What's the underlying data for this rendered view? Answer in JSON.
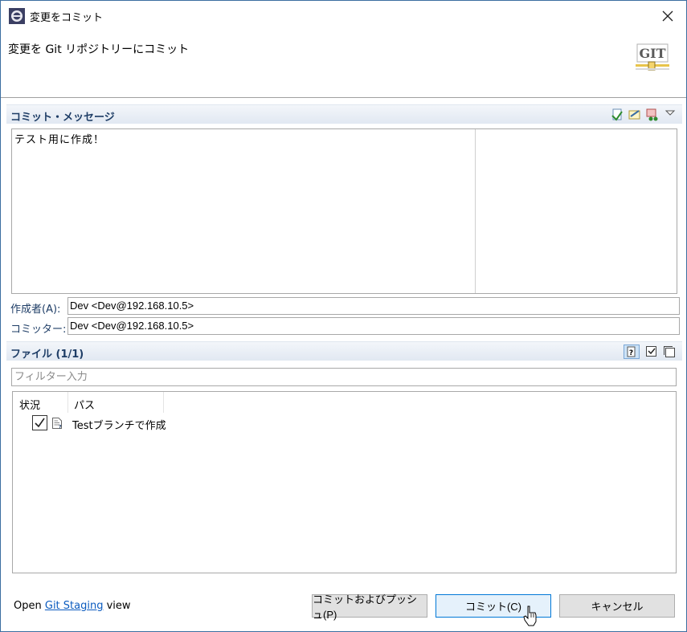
{
  "window": {
    "title": "変更をコミット",
    "header_text": "変更を Git リポジトリーにコミット",
    "logo_text": "GIT"
  },
  "commit_message": {
    "section_title": "コミット・メッセージ",
    "text": "テスト用に作成！",
    "toolbar_icons": [
      "ammend-icon",
      "sign-off-icon",
      "change-id-icon",
      "menu-dropdown-icon"
    ]
  },
  "fields": {
    "author_label": "作成者(A):",
    "author_value": "Dev <Dev@192.168.10.5>",
    "committer_label": "コミッター:",
    "committer_value": "Dev <Dev@192.168.10.5>"
  },
  "files": {
    "section_title": "ファイル (1/1)",
    "filter_placeholder": "フィルター入力",
    "columns": [
      "状況",
      "パス"
    ],
    "rows": [
      {
        "checked": true,
        "path": "Testブランチで作成"
      }
    ]
  },
  "footer": {
    "open_prefix": "Open",
    "link_text": "Git Staging",
    "open_suffix": "view",
    "commit_push_label": "コミットおよびプッシュ(P)",
    "commit_label": "コミット(C)",
    "cancel_label": "キャンセル"
  },
  "colors": {
    "accent": "#0078d7",
    "section_title": "#1e3d66",
    "link": "#0b5bbf"
  }
}
